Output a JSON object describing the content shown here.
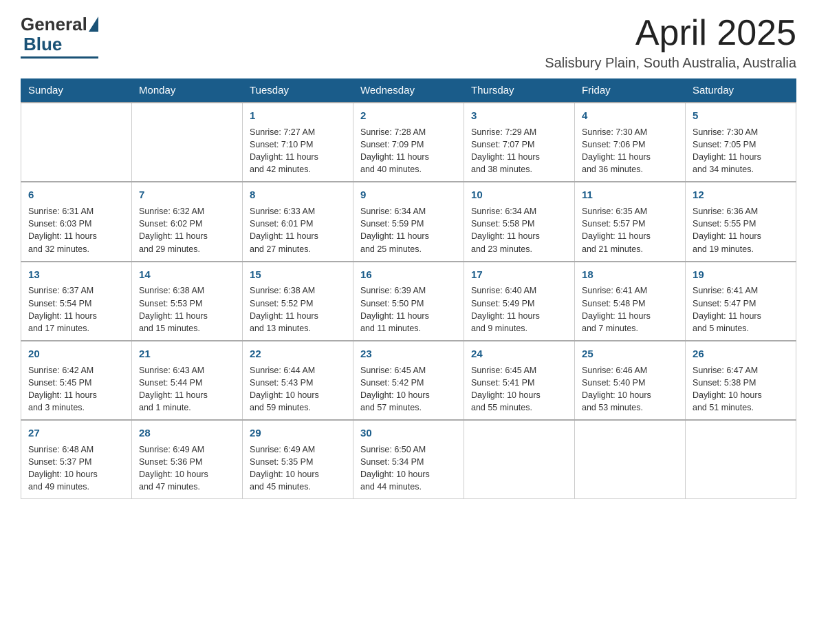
{
  "logo": {
    "general": "General",
    "blue": "Blue"
  },
  "header": {
    "month_year": "April 2025",
    "location": "Salisbury Plain, South Australia, Australia"
  },
  "days_of_week": [
    "Sunday",
    "Monday",
    "Tuesday",
    "Wednesday",
    "Thursday",
    "Friday",
    "Saturday"
  ],
  "weeks": [
    [
      {
        "day": "",
        "info": ""
      },
      {
        "day": "",
        "info": ""
      },
      {
        "day": "1",
        "info": "Sunrise: 7:27 AM\nSunset: 7:10 PM\nDaylight: 11 hours\nand 42 minutes."
      },
      {
        "day": "2",
        "info": "Sunrise: 7:28 AM\nSunset: 7:09 PM\nDaylight: 11 hours\nand 40 minutes."
      },
      {
        "day": "3",
        "info": "Sunrise: 7:29 AM\nSunset: 7:07 PM\nDaylight: 11 hours\nand 38 minutes."
      },
      {
        "day": "4",
        "info": "Sunrise: 7:30 AM\nSunset: 7:06 PM\nDaylight: 11 hours\nand 36 minutes."
      },
      {
        "day": "5",
        "info": "Sunrise: 7:30 AM\nSunset: 7:05 PM\nDaylight: 11 hours\nand 34 minutes."
      }
    ],
    [
      {
        "day": "6",
        "info": "Sunrise: 6:31 AM\nSunset: 6:03 PM\nDaylight: 11 hours\nand 32 minutes."
      },
      {
        "day": "7",
        "info": "Sunrise: 6:32 AM\nSunset: 6:02 PM\nDaylight: 11 hours\nand 29 minutes."
      },
      {
        "day": "8",
        "info": "Sunrise: 6:33 AM\nSunset: 6:01 PM\nDaylight: 11 hours\nand 27 minutes."
      },
      {
        "day": "9",
        "info": "Sunrise: 6:34 AM\nSunset: 5:59 PM\nDaylight: 11 hours\nand 25 minutes."
      },
      {
        "day": "10",
        "info": "Sunrise: 6:34 AM\nSunset: 5:58 PM\nDaylight: 11 hours\nand 23 minutes."
      },
      {
        "day": "11",
        "info": "Sunrise: 6:35 AM\nSunset: 5:57 PM\nDaylight: 11 hours\nand 21 minutes."
      },
      {
        "day": "12",
        "info": "Sunrise: 6:36 AM\nSunset: 5:55 PM\nDaylight: 11 hours\nand 19 minutes."
      }
    ],
    [
      {
        "day": "13",
        "info": "Sunrise: 6:37 AM\nSunset: 5:54 PM\nDaylight: 11 hours\nand 17 minutes."
      },
      {
        "day": "14",
        "info": "Sunrise: 6:38 AM\nSunset: 5:53 PM\nDaylight: 11 hours\nand 15 minutes."
      },
      {
        "day": "15",
        "info": "Sunrise: 6:38 AM\nSunset: 5:52 PM\nDaylight: 11 hours\nand 13 minutes."
      },
      {
        "day": "16",
        "info": "Sunrise: 6:39 AM\nSunset: 5:50 PM\nDaylight: 11 hours\nand 11 minutes."
      },
      {
        "day": "17",
        "info": "Sunrise: 6:40 AM\nSunset: 5:49 PM\nDaylight: 11 hours\nand 9 minutes."
      },
      {
        "day": "18",
        "info": "Sunrise: 6:41 AM\nSunset: 5:48 PM\nDaylight: 11 hours\nand 7 minutes."
      },
      {
        "day": "19",
        "info": "Sunrise: 6:41 AM\nSunset: 5:47 PM\nDaylight: 11 hours\nand 5 minutes."
      }
    ],
    [
      {
        "day": "20",
        "info": "Sunrise: 6:42 AM\nSunset: 5:45 PM\nDaylight: 11 hours\nand 3 minutes."
      },
      {
        "day": "21",
        "info": "Sunrise: 6:43 AM\nSunset: 5:44 PM\nDaylight: 11 hours\nand 1 minute."
      },
      {
        "day": "22",
        "info": "Sunrise: 6:44 AM\nSunset: 5:43 PM\nDaylight: 10 hours\nand 59 minutes."
      },
      {
        "day": "23",
        "info": "Sunrise: 6:45 AM\nSunset: 5:42 PM\nDaylight: 10 hours\nand 57 minutes."
      },
      {
        "day": "24",
        "info": "Sunrise: 6:45 AM\nSunset: 5:41 PM\nDaylight: 10 hours\nand 55 minutes."
      },
      {
        "day": "25",
        "info": "Sunrise: 6:46 AM\nSunset: 5:40 PM\nDaylight: 10 hours\nand 53 minutes."
      },
      {
        "day": "26",
        "info": "Sunrise: 6:47 AM\nSunset: 5:38 PM\nDaylight: 10 hours\nand 51 minutes."
      }
    ],
    [
      {
        "day": "27",
        "info": "Sunrise: 6:48 AM\nSunset: 5:37 PM\nDaylight: 10 hours\nand 49 minutes."
      },
      {
        "day": "28",
        "info": "Sunrise: 6:49 AM\nSunset: 5:36 PM\nDaylight: 10 hours\nand 47 minutes."
      },
      {
        "day": "29",
        "info": "Sunrise: 6:49 AM\nSunset: 5:35 PM\nDaylight: 10 hours\nand 45 minutes."
      },
      {
        "day": "30",
        "info": "Sunrise: 6:50 AM\nSunset: 5:34 PM\nDaylight: 10 hours\nand 44 minutes."
      },
      {
        "day": "",
        "info": ""
      },
      {
        "day": "",
        "info": ""
      },
      {
        "day": "",
        "info": ""
      }
    ]
  ]
}
